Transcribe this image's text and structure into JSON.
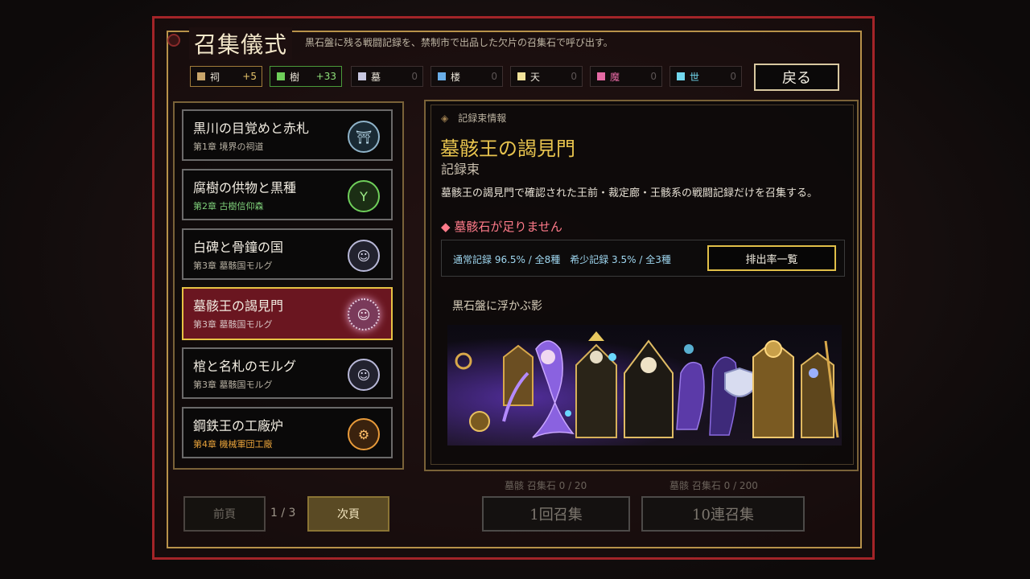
{
  "header": {
    "title": "召集儀式",
    "subtitle": "黒石盤に残る戦闘記録を、禁制市で出品した欠片の召集石で呼び出す。",
    "back_label": "戻る"
  },
  "currencies": [
    {
      "name": "祠",
      "count": "+5",
      "color": "#c9a66b"
    },
    {
      "name": "樹",
      "count": "+33",
      "color": "#6fcf5a"
    },
    {
      "name": "墓",
      "count": "0",
      "color": "#c7c7e0"
    },
    {
      "name": "楼",
      "count": "0",
      "color": "#6aaee8"
    },
    {
      "name": "天",
      "count": "0",
      "color": "#f1e29a"
    },
    {
      "name": "魔",
      "count": "0",
      "color": "#e56aa4"
    },
    {
      "name": "世",
      "count": "0",
      "color": "#72d8ee"
    }
  ],
  "list": [
    {
      "name": "黒川の目覚めと赤札",
      "sub": "第1章 境界の祠道",
      "icon": "torii-icon",
      "sub_color": "#b9b2a4"
    },
    {
      "name": "腐樹の供物と黒種",
      "sub": "第2章 古樹信仰森",
      "icon": "tree-icon",
      "sub_color": "#7fd07a"
    },
    {
      "name": "白碑と骨鐘の国",
      "sub": "第3章 墓骸国モルグ",
      "icon": "skull-icon",
      "sub_color": "#b9b2a4"
    },
    {
      "name": "墓骸王の謁見門",
      "sub": "第3章 墓骸国モルグ",
      "icon": "sun-skull-icon",
      "sub_color": "#d8c6c6"
    },
    {
      "name": "棺と名札のモルグ",
      "sub": "第3章 墓骸国モルグ",
      "icon": "skull-icon",
      "sub_color": "#b9b2a4"
    },
    {
      "name": "鋼鉄王の工廠炉",
      "sub": "第4章 機械軍団工廠",
      "icon": "gear-icon",
      "sub_color": "#e8a23a"
    }
  ],
  "detail": {
    "tag": "記録束情報",
    "title": "墓骸王の謁見門",
    "kind": "記録束",
    "desc": "墓骸王の謁見門で確認された王前・裁定廊・王骸系の戦闘記録だけを召集する。",
    "warning": "墓骸石が足りません",
    "rates": "通常記録 96.5% / 全8種　希少記録 3.5% / 全3種",
    "rate_button": "排出率一覧",
    "preview_label": "黒石盤に浮かぶ影"
  },
  "pager": {
    "prev": "前頁",
    "page": "1 / 3",
    "next": "次頁"
  },
  "summon": {
    "single_cost": "墓骸 召集石 0 / 20",
    "single_label": "1回召集",
    "multi_cost": "墓骸 召集石 0 / 200",
    "multi_label": "10連召集"
  }
}
